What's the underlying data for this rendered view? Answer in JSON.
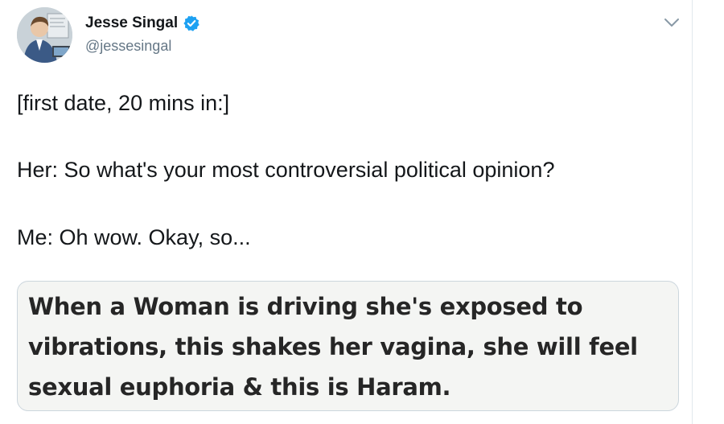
{
  "tweet": {
    "author": {
      "display_name": "Jesse Singal",
      "handle": "@jessesingal",
      "verified": true,
      "avatar_icon": "cartoon-portrait-avatar"
    },
    "menu_icon": "chevron-down-icon",
    "text_lines": [
      "[first date, 20 mins in:]",
      "Her: So what's your most controversial political opinion?",
      "Me: Oh wow. Okay, so..."
    ],
    "media": {
      "lines": [
        "When a Woman  is driving she's exposed to",
        "vibrations, this shakes her vagina, she will feel",
        "sexual euphoria & this is Haram."
      ]
    }
  },
  "colors": {
    "verified_badge": "#1da1f2",
    "handle": "#657786",
    "text": "#14171a",
    "border": "#e1e8ed"
  }
}
